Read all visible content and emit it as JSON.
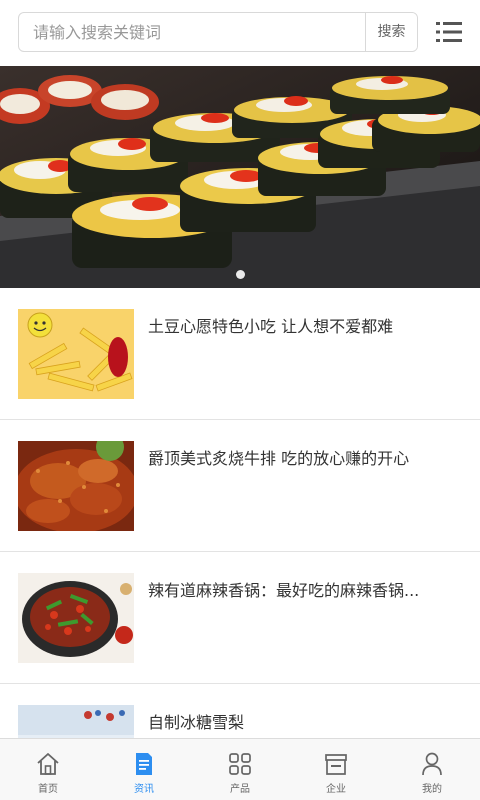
{
  "search": {
    "placeholder": "请输入搜索关键词",
    "button_label": "搜索"
  },
  "banner": {
    "slide_count": 1,
    "active_index": 0
  },
  "news": [
    {
      "title": "土豆心愿特色小吃 让人想不爱都难"
    },
    {
      "title": "爵顶美式炙烧牛排 吃的放心赚的开心"
    },
    {
      "title": "辣有道麻辣香锅：最好吃的麻辣香锅..."
    },
    {
      "title": "自制冰糖雪梨"
    }
  ],
  "tabs": [
    {
      "label": "首页",
      "icon": "home-icon",
      "active": false
    },
    {
      "label": "资讯",
      "icon": "news-icon",
      "active": true
    },
    {
      "label": "产品",
      "icon": "grid-icon",
      "active": false
    },
    {
      "label": "企业",
      "icon": "store-icon",
      "active": false
    },
    {
      "label": "我的",
      "icon": "user-icon",
      "active": false
    }
  ],
  "colors": {
    "accent": "#2d8ef0",
    "tab_inactive": "#666666",
    "divider": "#e3e3e3"
  }
}
